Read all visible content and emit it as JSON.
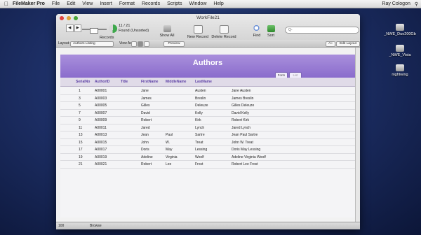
{
  "menubar": {
    "app_name": "FileMaker Pro",
    "items": [
      "File",
      "Edit",
      "View",
      "Insert",
      "Format",
      "Records",
      "Scripts",
      "Window",
      "Help"
    ],
    "user": "Ray Cologon"
  },
  "desktop_icons": [
    {
      "label": "_NWE_Duo200Gb"
    },
    {
      "label": "_NWE_Vista"
    },
    {
      "label": "nightwing"
    }
  ],
  "window": {
    "title": "WorkFile21",
    "record_counter": "11 / 21",
    "found_status": "Found (Unsorted)",
    "records_label": "Records",
    "toolbar": {
      "show_all": "Show All",
      "new_record": "New Record",
      "delete_record": "Delete Record",
      "find": "Find",
      "sort": "Sort"
    },
    "search_placeholder": "Q-",
    "layout_label": "Layout:",
    "layout_value": "Authors Listing",
    "view_as_label": "View As:",
    "preview_label": "Preview",
    "font_size_btn": "A»",
    "edit_layout": "Edit Layout",
    "status": {
      "zoom": "100",
      "mode": "Browse"
    }
  },
  "layout": {
    "title": "Authors",
    "form_btn": "Form",
    "list_btn": "List",
    "columns": [
      "SerialNo",
      "AuthorID",
      "Title",
      "FirstName",
      "MiddleName",
      "LastName"
    ],
    "rows": [
      {
        "serial": "1",
        "id": "A00001",
        "title": "",
        "first": "Jane",
        "middle": "",
        "last": "Austen",
        "full": "Jane Austen"
      },
      {
        "serial": "3",
        "id": "A00003",
        "title": "",
        "first": "James",
        "middle": "",
        "last": "Breslin",
        "full": "James Breslin"
      },
      {
        "serial": "5",
        "id": "A00005",
        "title": "",
        "first": "Gilles",
        "middle": "",
        "last": "Deleuze",
        "full": "Gilles Deleuze"
      },
      {
        "serial": "7",
        "id": "A00007",
        "title": "",
        "first": "David",
        "middle": "",
        "last": "Kelly",
        "full": "David Kelly"
      },
      {
        "serial": "9",
        "id": "A00009",
        "title": "",
        "first": "Robert",
        "middle": "",
        "last": "Kirk",
        "full": "Robert Kirk"
      },
      {
        "serial": "11",
        "id": "A00011",
        "title": "",
        "first": "Jared",
        "middle": "",
        "last": "Lynch",
        "full": "Jared Lynch"
      },
      {
        "serial": "13",
        "id": "A00013",
        "title": "",
        "first": "Jean",
        "middle": "Paul",
        "last": "Sartre",
        "full": "Jean Paul Sartre"
      },
      {
        "serial": "15",
        "id": "A00015",
        "title": "",
        "first": "John",
        "middle": "W.",
        "last": "Treat",
        "full": "John W. Treat"
      },
      {
        "serial": "17",
        "id": "A00017",
        "title": "",
        "first": "Doris",
        "middle": "May",
        "last": "Lessing",
        "full": "Doris May Lessing"
      },
      {
        "serial": "19",
        "id": "A00019",
        "title": "",
        "first": "Adeline",
        "middle": "Virginia",
        "last": "Woolf",
        "full": "Adeline Virginia Woolf"
      },
      {
        "serial": "21",
        "id": "A00021",
        "title": "",
        "first": "Robert",
        "middle": "Lee",
        "last": "Frost",
        "full": "Robert Lee Frost"
      }
    ]
  }
}
